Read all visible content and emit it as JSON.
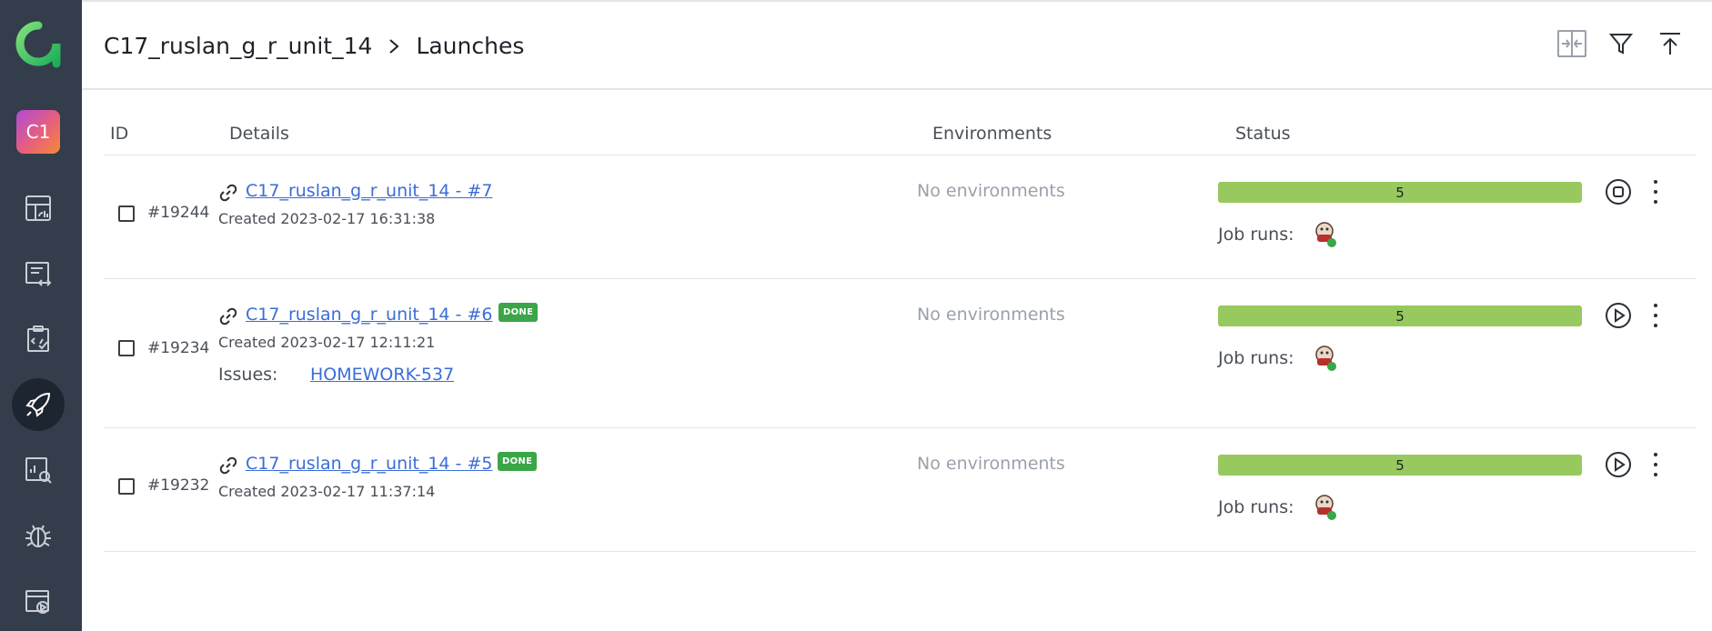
{
  "app": {
    "project_badge": "C1"
  },
  "header": {
    "project": "C17_ruslan_g_r_unit_14",
    "page": "Launches",
    "icons": [
      "compare-icon",
      "filter-icon",
      "upload-icon"
    ]
  },
  "table": {
    "columns": {
      "id": "ID",
      "details": "Details",
      "environments": "Environments",
      "status": "Status"
    },
    "rows": [
      {
        "id": "#19244",
        "name": "C17_ruslan_g_r_unit_14 - #7",
        "badge": "",
        "created": "Created 2023-02-17 16:31:38",
        "issues_label": "",
        "issue": "",
        "environments": "No environments",
        "status_count": "5",
        "job_runs": "Job runs:",
        "action": "stop"
      },
      {
        "id": "#19234",
        "name": "C17_ruslan_g_r_unit_14 - #6",
        "badge": "DONE",
        "created": "Created 2023-02-17 12:11:21",
        "issues_label": "Issues:",
        "issue": "HOMEWORK-537",
        "environments": "No environments",
        "status_count": "5",
        "job_runs": "Job runs:",
        "action": "play"
      },
      {
        "id": "#19232",
        "name": "C17_ruslan_g_r_unit_14 - #5",
        "badge": "DONE",
        "created": "Created 2023-02-17 11:37:14",
        "issues_label": "",
        "issue": "",
        "environments": "No environments",
        "status_count": "5",
        "job_runs": "Job runs:",
        "action": "play"
      }
    ]
  },
  "colors": {
    "sidebar": "#343d4b",
    "link": "#3b6dd8",
    "status_passed": "#97c95e",
    "done_badge": "#3aa647"
  }
}
